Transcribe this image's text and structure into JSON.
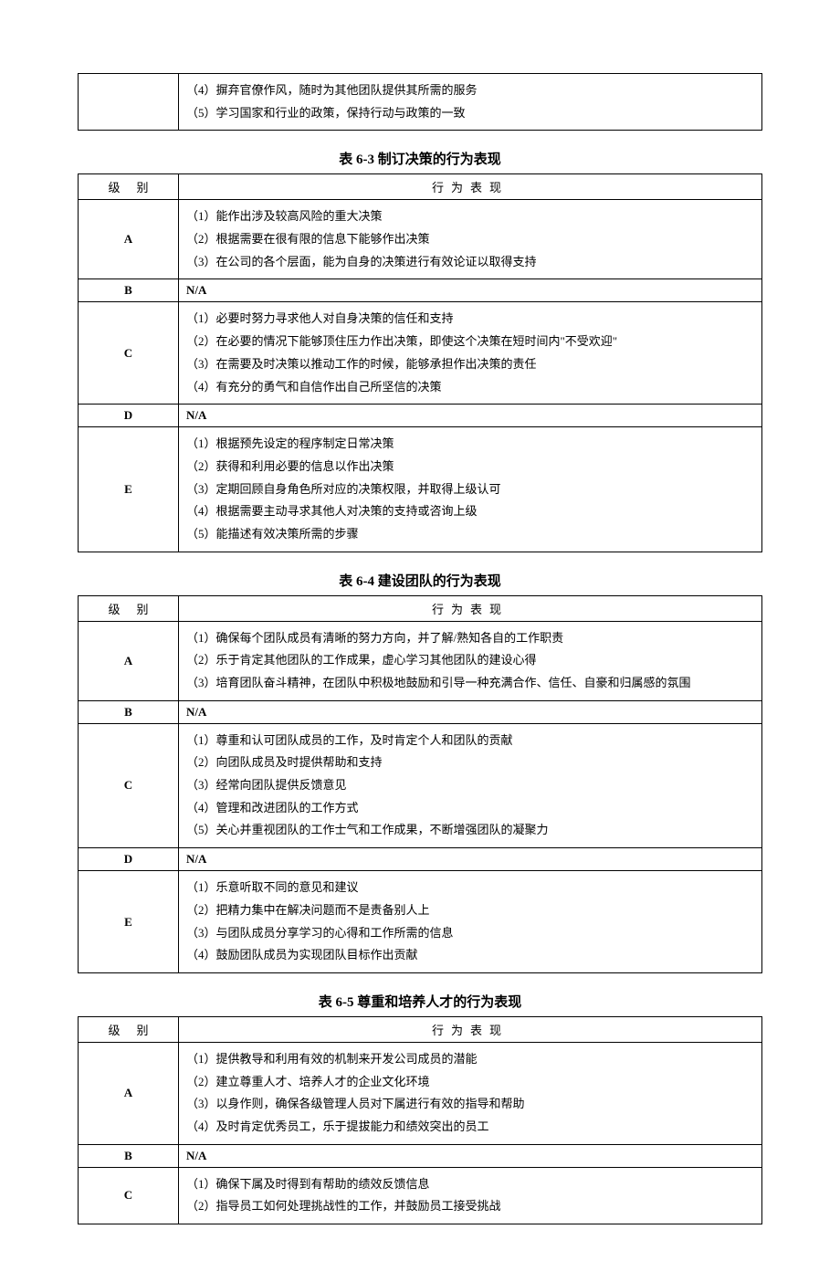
{
  "table_top_fragment": {
    "rows": [
      "（4）摒弃官僚作风，随时为其他团队提供其所需的服务",
      "（5）学习国家和行业的政策，保持行动与政策的一致"
    ]
  },
  "table63": {
    "title": "表 6-3    制订决策的行为表现",
    "header": {
      "level": "级别",
      "behavior": "行为表现"
    },
    "rows": [
      {
        "level": "A",
        "items": [
          "（1）能作出涉及较高风险的重大决策",
          "（2）根据需要在很有限的信息下能够作出决策",
          "（3）在公司的各个层面，能为自身的决策进行有效论证以取得支持"
        ]
      },
      {
        "level": "B",
        "na": "N/A"
      },
      {
        "level": "C",
        "items": [
          "（1）必要时努力寻求他人对自身决策的信任和支持",
          "（2）在必要的情况下能够顶住压力作出决策，即使这个决策在短时间内\"不受欢迎\"",
          "（3）在需要及时决策以推动工作的时候，能够承担作出决策的责任",
          "（4）有充分的勇气和自信作出自己所坚信的决策"
        ]
      },
      {
        "level": "D",
        "na": "N/A"
      },
      {
        "level": "E",
        "items": [
          "（1）根据预先设定的程序制定日常决策",
          "（2）获得和利用必要的信息以作出决策",
          "（3）定期回顾自身角色所对应的决策权限，并取得上级认可",
          "（4）根据需要主动寻求其他人对决策的支持或咨询上级",
          "（5）能描述有效决策所需的步骤"
        ]
      }
    ]
  },
  "table64": {
    "title": "表 6-4    建设团队的行为表现",
    "header": {
      "level": "级别",
      "behavior": "行为表现"
    },
    "rows": [
      {
        "level": "A",
        "items": [
          "（1）确保每个团队成员有清晰的努力方向，并了解/熟知各自的工作职责",
          "（2）乐于肯定其他团队的工作成果，虚心学习其他团队的建设心得",
          "（3）培育团队奋斗精神，在团队中积极地鼓励和引导一种充满合作、信任、自豪和归属感的氛围"
        ]
      },
      {
        "level": "B",
        "na": "N/A"
      },
      {
        "level": "C",
        "items": [
          "（1）尊重和认可团队成员的工作，及时肯定个人和团队的贡献",
          "（2）向团队成员及时提供帮助和支持",
          "（3）经常向团队提供反馈意见",
          "（4）管理和改进团队的工作方式",
          "（5）关心并重视团队的工作士气和工作成果，不断增强团队的凝聚力"
        ]
      },
      {
        "level": "D",
        "na": "N/A"
      },
      {
        "level": "E",
        "items": [
          "（1）乐意听取不同的意见和建议",
          "（2）把精力集中在解决问题而不是责备别人上",
          "（3）与团队成员分享学习的心得和工作所需的信息",
          "（4）鼓励团队成员为实现团队目标作出贡献"
        ]
      }
    ]
  },
  "table65": {
    "title": "表 6-5    尊重和培养人才的行为表现",
    "header": {
      "level": "级别",
      "behavior": "行为表现"
    },
    "rows": [
      {
        "level": "A",
        "items": [
          "（1）提供教导和利用有效的机制来开发公司成员的潜能",
          "（2）建立尊重人才、培养人才的企业文化环境",
          "（3）以身作则，确保各级管理人员对下属进行有效的指导和帮助",
          "（4）及时肯定优秀员工，乐于提拔能力和绩效突出的员工"
        ]
      },
      {
        "level": "B",
        "na": "N/A"
      },
      {
        "level": "C",
        "items": [
          "（1）确保下属及时得到有帮助的绩效反馈信息",
          "（2）指导员工如何处理挑战性的工作，并鼓励员工接受挑战"
        ]
      }
    ]
  }
}
